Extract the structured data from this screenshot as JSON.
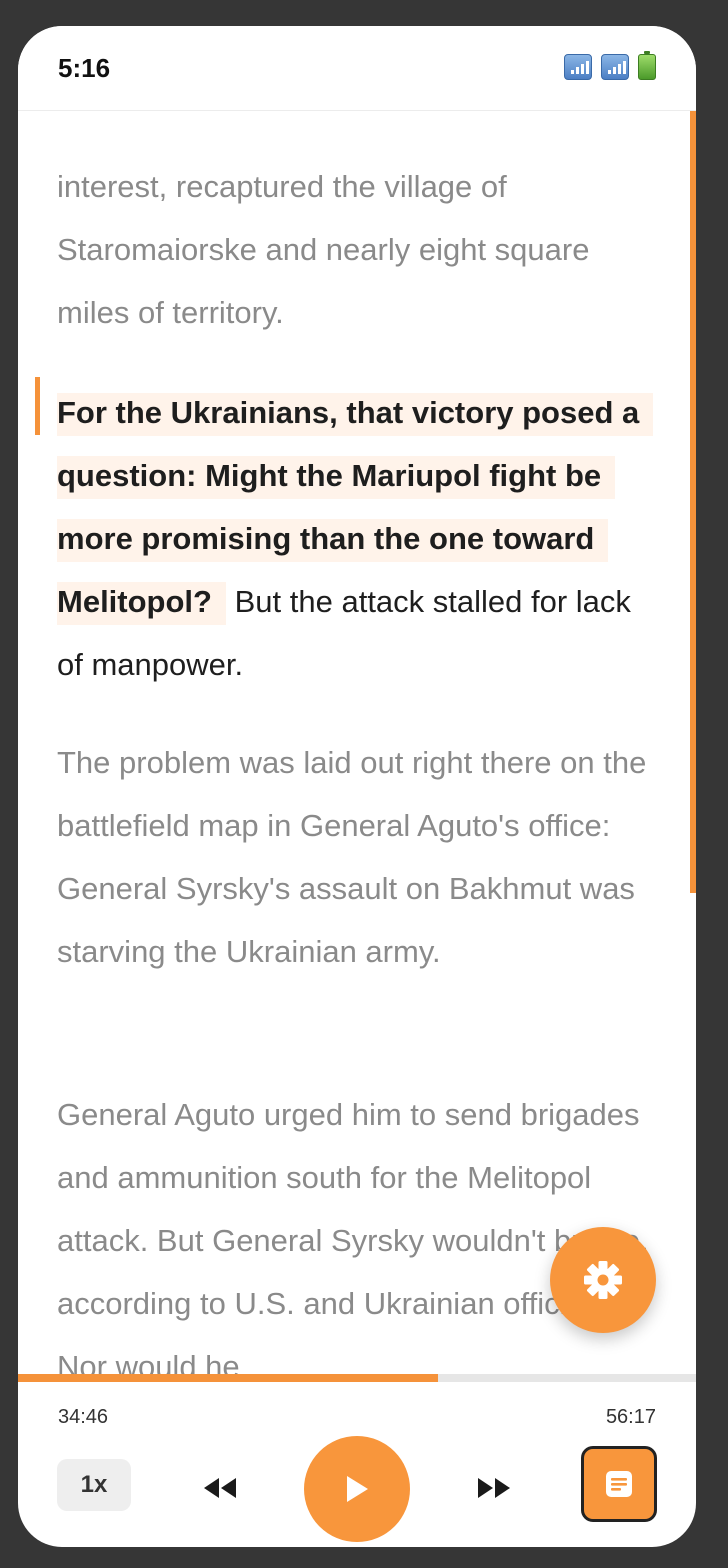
{
  "status_bar": {
    "time": "5:16",
    "icons": [
      "cellular-signal-icon",
      "cellular-signal-icon",
      "battery-icon"
    ]
  },
  "article": {
    "para_before": "interest, recaptured the village of Staromaiorske and nearly eight square miles of territory.",
    "active_para_highlight": "For the Ukrainians, that victory posed a question: Might the Mariupol fight be more promising than the one toward Melitopol?",
    "active_para_rest": "But the attack stalled for lack of manpower.",
    "para_after_1": "The problem was laid out right there on the battlefield map in General Aguto's office: General Syrsky's assault on Bakhmut was starving the Ukrainian army.",
    "para_after_2": "General Aguto urged him to send brigades and ammunition south for the Melitopol attack. But General Syrsky wouldn't budge, according to U.S. and Ukrainian officials. Nor would he"
  },
  "player": {
    "elapsed": "34:46",
    "total": "56:17",
    "progress_fraction": 0.62,
    "speed_label": "1x",
    "icons": {
      "rewind": "rewind-icon",
      "play": "play-icon",
      "forward": "fast-forward-icon",
      "settings": "gear-icon",
      "text": "text-document-icon"
    }
  },
  "colors": {
    "accent": "#f8963c",
    "highlight_bg": "#fff3ea",
    "inactive_text": "#8a8a8a",
    "active_text": "#1e1e1e"
  }
}
